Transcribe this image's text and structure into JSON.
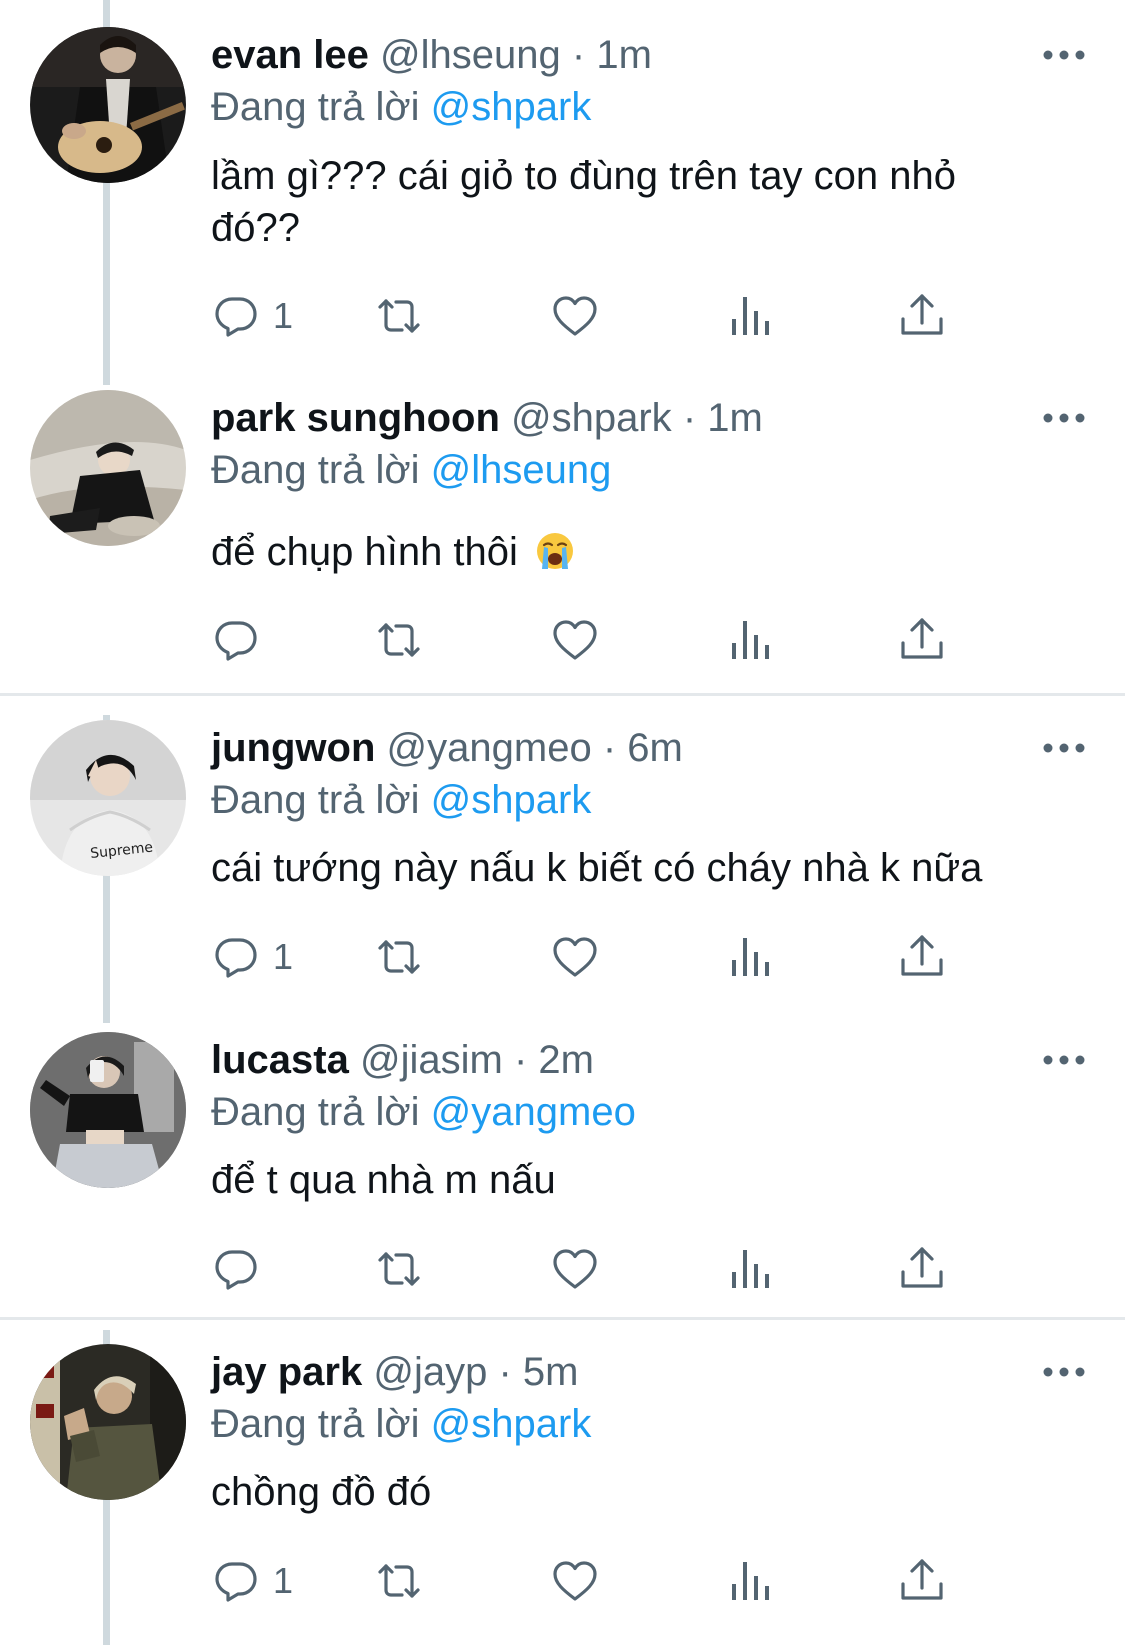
{
  "reply_prefix": "Đang trả lời",
  "tweets": [
    {
      "name": "evan lee",
      "handle": "@lhseung",
      "time": "1m",
      "reply_to": "@shpark",
      "text_line1": "lầm gì??? cái giỏ to đùng trên tay con nhỏ",
      "text_line2": "đó??",
      "reply_count": "1",
      "avatar_icon": "avatar-guitar-photo"
    },
    {
      "name": "park sunghoon",
      "handle": "@shpark",
      "time": "1m",
      "reply_to": "@lhseung",
      "text": "để chụp hình thôi",
      "emoji": "loudly-crying-face-emoji",
      "reply_count": "",
      "avatar_icon": "avatar-sofa-photo"
    },
    {
      "name": "jungwon",
      "handle": "@yangmeo",
      "time": "6m",
      "reply_to": "@shpark",
      "text": "cái tướng này nấu k biết có cháy nhà k nữa",
      "reply_count": "1",
      "avatar_icon": "avatar-hoodie-photo"
    },
    {
      "name": "lucasta",
      "handle": "@jiasim",
      "time": "2m",
      "reply_to": "@yangmeo",
      "text": "để t qua nhà m nấu",
      "reply_count": "",
      "avatar_icon": "avatar-mirror-selfie-photo"
    },
    {
      "name": "jay park",
      "handle": "@jayp",
      "time": "5m",
      "reply_to": "@shpark",
      "text": "chồng đồ đó",
      "reply_count": "1",
      "avatar_icon": "avatar-night-street-photo"
    }
  ],
  "separator": "·",
  "colors": {
    "link": "#1d9bf0",
    "secondary_text": "#536471",
    "thread_line": "#cfd9de",
    "divider": "#e4e8eb"
  }
}
